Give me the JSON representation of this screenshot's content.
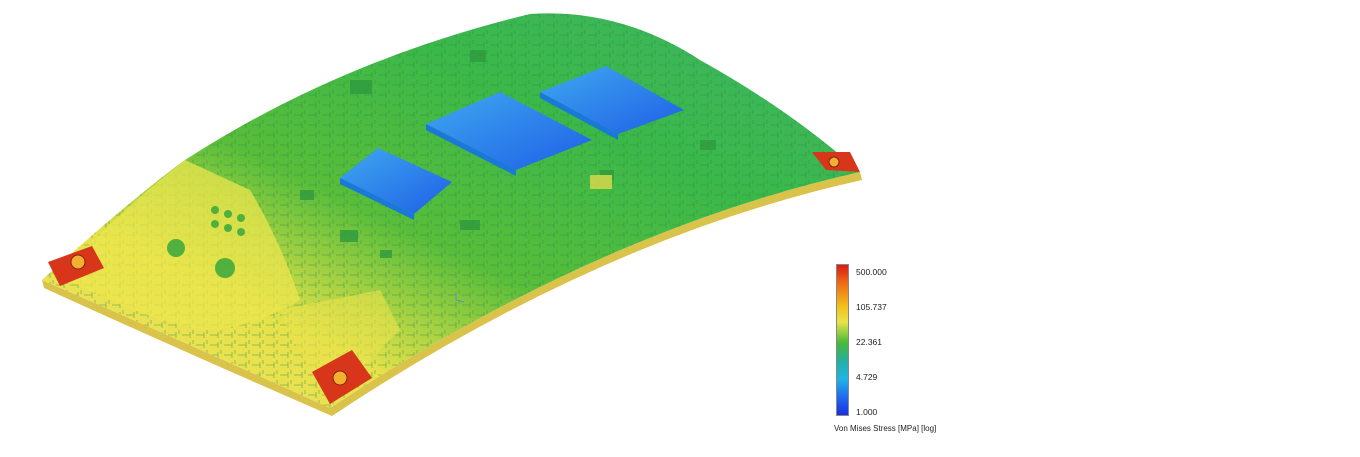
{
  "legend": {
    "ticks": [
      "500.000",
      "105.737",
      "22.361",
      "4.729",
      "1.000"
    ],
    "title": "Von Mises Stress [MPa] [log]",
    "colors": [
      "#d81c12",
      "#ef6a16",
      "#f2c21a",
      "#e8e44a",
      "#48b837",
      "#22b0a0",
      "#1fb4e6",
      "#1f5ff0",
      "#1a2fe0"
    ]
  }
}
